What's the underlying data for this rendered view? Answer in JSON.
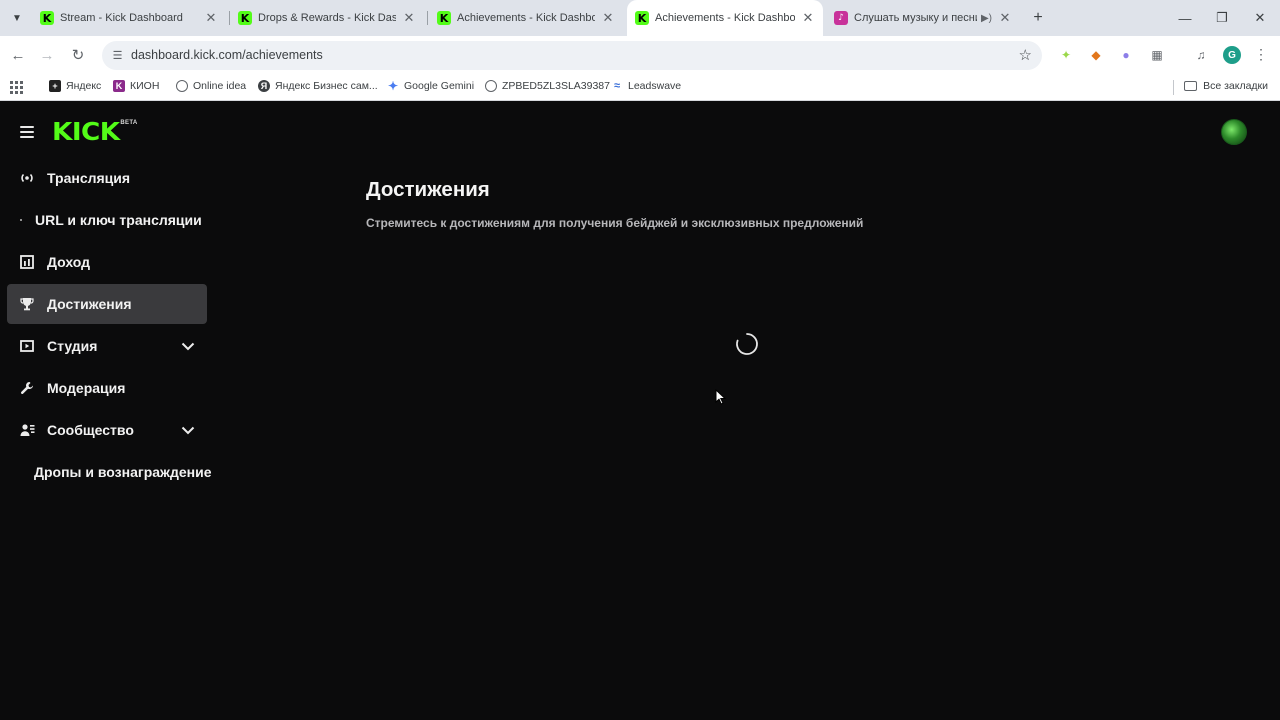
{
  "browser": {
    "tabs": [
      {
        "title": "Stream - Kick Dashboard",
        "favicon": "K",
        "active": false
      },
      {
        "title": "Drops & Rewards - Kick Dashboard",
        "favicon": "K",
        "active": false
      },
      {
        "title": "Achievements - Kick Dashboard",
        "favicon": "K",
        "active": false
      },
      {
        "title": "Achievements - Kick Dashboard",
        "favicon": "K",
        "active": true
      },
      {
        "title": "Слушать музыку и песни онлайн",
        "favicon": "music-icon",
        "active": false,
        "audio": true
      }
    ],
    "url": "dashboard.kick.com/achievements",
    "profile_initial": "G",
    "bookmarks": [
      {
        "label": "Яндекс",
        "icon": "yandex-icon"
      },
      {
        "label": "КИОН",
        "icon": "kion-icon"
      },
      {
        "label": "Online idea",
        "icon": "globe-icon"
      },
      {
        "label": "Яндекс Бизнес сам...",
        "icon": "yandex-business-icon"
      },
      {
        "label": "Google Gemini",
        "icon": "gemini-icon"
      },
      {
        "label": "ZPBED5ZL3SLA39387",
        "icon": "globe-icon"
      },
      {
        "label": "Leadswave",
        "icon": "leadswave-icon"
      }
    ],
    "all_bookmarks": "Все закладки"
  },
  "app": {
    "logo_text": "KICK",
    "logo_badge": "BETA",
    "accent": "#53fc18"
  },
  "sidebar": {
    "items": [
      {
        "label": "Трансляция",
        "icon": "broadcast-icon"
      },
      {
        "label": "URL и ключ трансляции",
        "icon": "bullet-icon",
        "sub": true
      },
      {
        "label": "Доход",
        "icon": "chart-icon"
      },
      {
        "label": "Достижения",
        "icon": "trophy-icon",
        "active": true
      },
      {
        "label": "Студия",
        "icon": "studio-icon",
        "expandable": true
      },
      {
        "label": "Модерация",
        "icon": "wrench-icon"
      },
      {
        "label": "Сообщество",
        "icon": "community-icon",
        "expandable": true
      },
      {
        "label": "Дропы и вознаграждение",
        "sub": true
      }
    ]
  },
  "main": {
    "title": "Достижения",
    "subtitle": "Стремитесь к достижениям для получения бейджей и эксклюзивных предложений",
    "loading": true
  }
}
